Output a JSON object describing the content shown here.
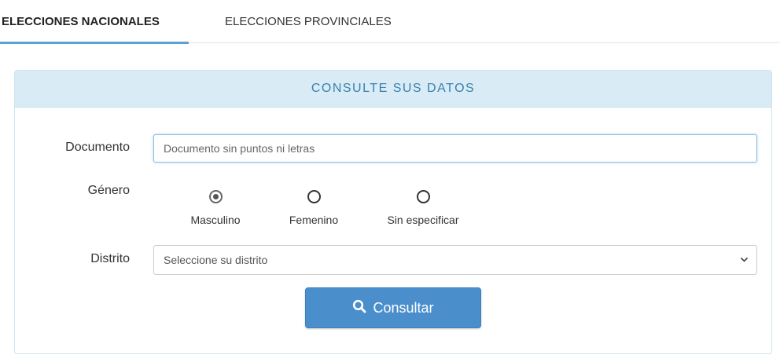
{
  "tabs": [
    {
      "label": "ELECCIONES NACIONALES",
      "active": true
    },
    {
      "label": "ELECCIONES PROVINCIALES",
      "active": false
    }
  ],
  "panel": {
    "title": "CONSULTE SUS DATOS"
  },
  "form": {
    "documento": {
      "label": "Documento",
      "placeholder": "Documento sin puntos ni letras",
      "value": ""
    },
    "genero": {
      "label": "Género",
      "options": [
        {
          "label": "Masculino",
          "checked": true
        },
        {
          "label": "Femenino",
          "checked": false
        },
        {
          "label": "Sin especificar",
          "checked": false
        }
      ]
    },
    "distrito": {
      "label": "Distrito",
      "selected": "Seleccione su distrito"
    },
    "submit": {
      "label": "Consultar",
      "icon": "search-icon"
    }
  },
  "colors": {
    "accent": "#4a8fcc",
    "panel_header_bg": "#d9ecf6",
    "panel_header_text": "#3a7fae",
    "active_tab_underline": "#5aa2d4"
  }
}
